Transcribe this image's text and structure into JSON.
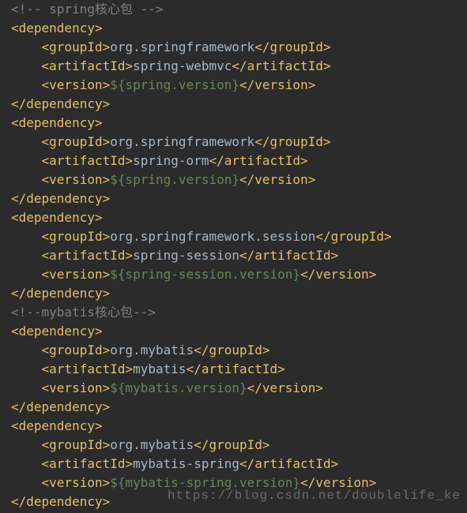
{
  "watermark": "https://blog.csdn.net/doublelife_ke",
  "lines": [
    [
      [
        "comment",
        "<!-- spring核心包 -->"
      ]
    ],
    [
      [
        "tag",
        "<dependency>"
      ]
    ],
    [
      [
        "tag",
        "    <groupId>"
      ],
      [
        "text",
        "org.springframework"
      ],
      [
        "tag",
        "</groupId>"
      ]
    ],
    [
      [
        "tag",
        "    <artifactId>"
      ],
      [
        "text",
        "spring-webmvc"
      ],
      [
        "tag",
        "</artifactId>"
      ]
    ],
    [
      [
        "tag",
        "    <version>"
      ],
      [
        "var",
        "${spring.version}"
      ],
      [
        "tag",
        "</version>"
      ]
    ],
    [
      [
        "tag",
        "</dependency>"
      ]
    ],
    [
      [
        "tag",
        "<dependency>"
      ]
    ],
    [
      [
        "tag",
        "    <groupId>"
      ],
      [
        "text",
        "org.springframework"
      ],
      [
        "tag",
        "</groupId>"
      ]
    ],
    [
      [
        "tag",
        "    <artifactId>"
      ],
      [
        "text",
        "spring-orm"
      ],
      [
        "tag",
        "</artifactId>"
      ]
    ],
    [
      [
        "tag",
        "    <version>"
      ],
      [
        "var",
        "${spring.version}"
      ],
      [
        "tag",
        "</version>"
      ]
    ],
    [
      [
        "tag",
        "</dependency>"
      ]
    ],
    [
      [
        "tag",
        "<dependency>"
      ]
    ],
    [
      [
        "tag",
        "    <groupId>"
      ],
      [
        "text",
        "org.springframework.session"
      ],
      [
        "tag",
        "</groupId>"
      ]
    ],
    [
      [
        "tag",
        "    <artifactId>"
      ],
      [
        "text",
        "spring-session"
      ],
      [
        "tag",
        "</artifactId>"
      ]
    ],
    [
      [
        "tag",
        "    <version>"
      ],
      [
        "var",
        "${spring-session.version}"
      ],
      [
        "tag",
        "</version>"
      ]
    ],
    [
      [
        "tag",
        "</dependency>"
      ]
    ],
    [
      [
        "comment",
        "<!--mybatis核心包-->"
      ]
    ],
    [
      [
        "tag",
        "<dependency>"
      ]
    ],
    [
      [
        "tag",
        "    <groupId>"
      ],
      [
        "text",
        "org.mybatis"
      ],
      [
        "tag",
        "</groupId>"
      ]
    ],
    [
      [
        "tag",
        "    <artifactId>"
      ],
      [
        "text",
        "mybatis"
      ],
      [
        "tag",
        "</artifactId>"
      ]
    ],
    [
      [
        "tag",
        "    <version>"
      ],
      [
        "var",
        "${mybatis.version}"
      ],
      [
        "tag",
        "</version>"
      ]
    ],
    [
      [
        "tag",
        "</dependency>"
      ]
    ],
    [
      [
        "tag",
        "<dependency>"
      ]
    ],
    [
      [
        "tag",
        "    <groupId>"
      ],
      [
        "text",
        "org.mybatis"
      ],
      [
        "tag",
        "</groupId>"
      ]
    ],
    [
      [
        "tag",
        "    <artifactId>"
      ],
      [
        "text",
        "mybatis-spring"
      ],
      [
        "tag",
        "</artifactId>"
      ]
    ],
    [
      [
        "tag",
        "    <version>"
      ],
      [
        "var",
        "${mybatis-spring.version}"
      ],
      [
        "tag",
        "</version>"
      ]
    ],
    [
      [
        "tag",
        "</dependency>"
      ]
    ]
  ]
}
